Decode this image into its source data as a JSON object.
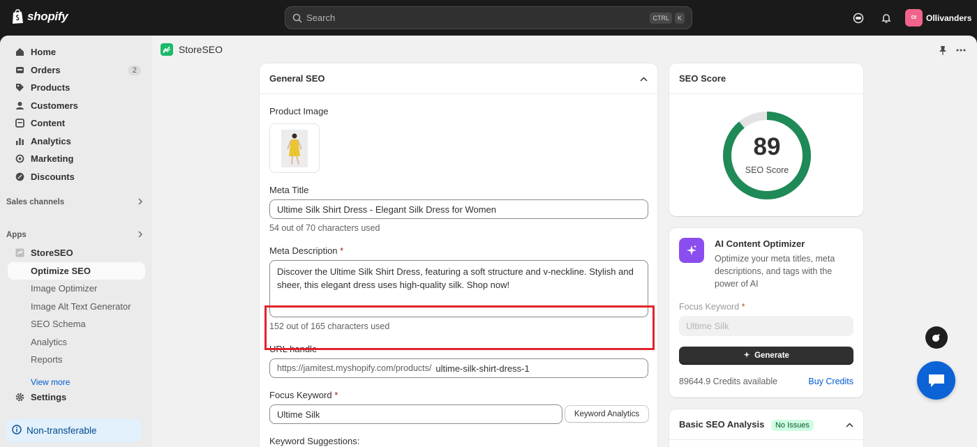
{
  "topbar": {
    "brand": "shopify",
    "search_placeholder": "Search",
    "kbd_ctrl": "CTRL",
    "kbd_k": "K",
    "store_initials": "OI",
    "store_name": "Ollivanders"
  },
  "sidebar": {
    "items": [
      {
        "label": "Home",
        "icon": "home-icon"
      },
      {
        "label": "Orders",
        "icon": "orders-icon",
        "badge": "2"
      },
      {
        "label": "Products",
        "icon": "tag-icon"
      },
      {
        "label": "Customers",
        "icon": "person-icon"
      },
      {
        "label": "Content",
        "icon": "content-icon"
      },
      {
        "label": "Analytics",
        "icon": "bar-chart-icon"
      },
      {
        "label": "Marketing",
        "icon": "target-icon"
      },
      {
        "label": "Discounts",
        "icon": "discount-icon"
      }
    ],
    "sales_channels": "Sales channels",
    "apps": "Apps",
    "app_name": "StoreSEO",
    "sub_items": [
      "Optimize SEO",
      "Image Optimizer",
      "Image Alt Text Generator",
      "SEO Schema",
      "Analytics",
      "Reports"
    ],
    "view_more": "View more",
    "settings": "Settings",
    "non_transferable": "Non-transferable"
  },
  "app": {
    "title": "StoreSEO"
  },
  "general_seo": {
    "title": "General SEO",
    "product_image_label": "Product Image",
    "meta_title_label": "Meta Title",
    "meta_title_value": "Ultime Silk Shirt Dress - Elegant Silk Dress for Women",
    "meta_title_help": "54 out of 70 characters used",
    "meta_desc_label": "Meta Description",
    "required_mark": "*",
    "meta_desc_value": "Discover the Ultime Silk Shirt Dress, featuring a soft structure and v-neckline. Stylish and sheer, this elegant dress uses high-quality silk. Shop now!",
    "meta_desc_help": "152 out of 165 characters used",
    "url_label": "URL handle",
    "url_prefix": "https://jamitest.myshopify.com/products/",
    "url_value": "ultime-silk-shirt-dress-1",
    "focus_label": "Focus Keyword",
    "focus_value": "Ultime Silk",
    "keyword_button": "Keyword Analytics",
    "suggestions_label": "Keyword Suggestions:"
  },
  "seo_score": {
    "title": "SEO Score",
    "value": "89",
    "percent": 89,
    "label": "SEO Score",
    "color": "#1f8a57"
  },
  "ai_optimizer": {
    "title": "AI Content Optimizer",
    "description": "Optimize your meta titles, meta descriptions, and tags with the power of AI",
    "focus_label": "Focus Keyword",
    "focus_placeholder": "Ultime Silk",
    "generate_label": "Generate",
    "credits": "89644.9 Credits available",
    "buy_label": "Buy Credits"
  },
  "basic_analysis": {
    "title": "Basic SEO Analysis",
    "badge": "No Issues"
  }
}
